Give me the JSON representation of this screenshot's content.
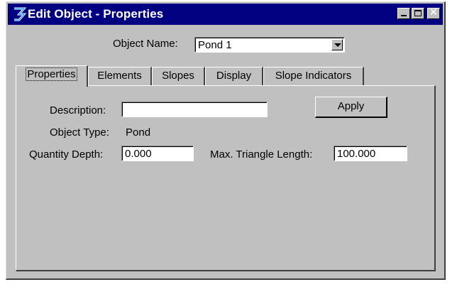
{
  "window": {
    "title": "Edit Object - Properties",
    "logo_icon": "geopak-logo-icon",
    "controls": {
      "close_glyph": "×"
    }
  },
  "object_name": {
    "label": "Object Name:",
    "value": "Pond 1"
  },
  "tabs": [
    {
      "label": "Properties",
      "active": true
    },
    {
      "label": "Elements",
      "active": false
    },
    {
      "label": "Slopes",
      "active": false
    },
    {
      "label": "Display",
      "active": false
    },
    {
      "label": "Slope Indicators",
      "active": false
    }
  ],
  "properties": {
    "description_label": "Description:",
    "description_value": "",
    "apply_label": "Apply",
    "object_type_label": "Object Type:",
    "object_type_value": "Pond",
    "quantity_depth_label": "Quantity Depth:",
    "quantity_depth_value": "0.000",
    "max_triangle_label": "Max. Triangle Length:",
    "max_triangle_value": "100.000"
  },
  "colors": {
    "titlebar": "#000080",
    "face": "#c0c0c0",
    "field": "#ffffff"
  }
}
